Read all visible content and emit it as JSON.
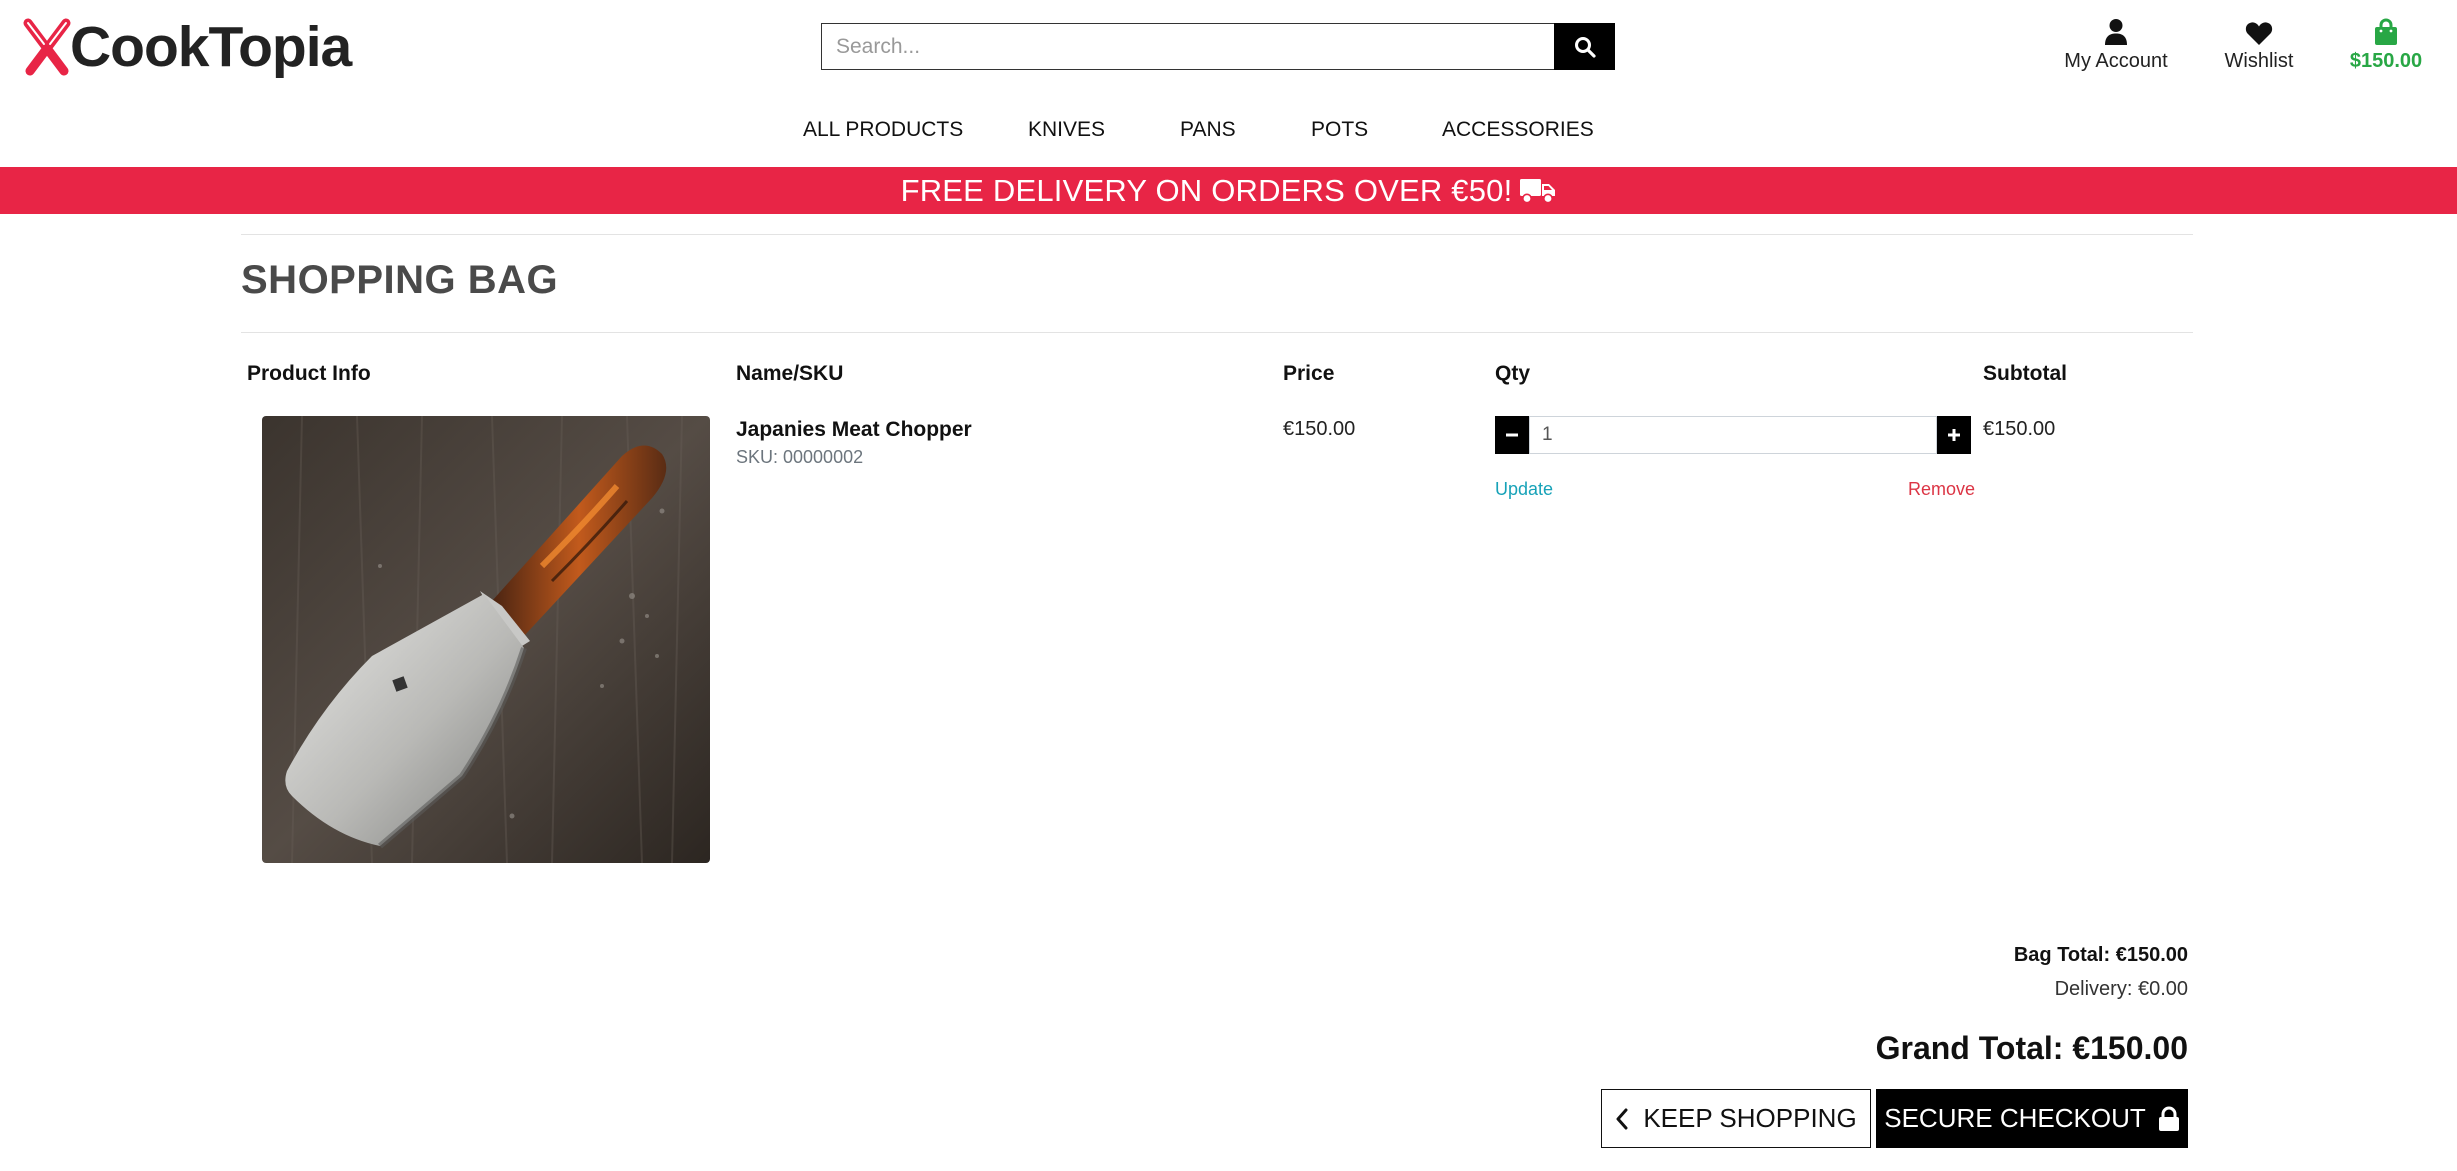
{
  "brand": {
    "name": "CookTopia",
    "accent_color": "#e82546",
    "logo_icon": "crossed-knives-icon"
  },
  "search": {
    "placeholder": "Search...",
    "button_icon": "search-icon"
  },
  "header": {
    "account_label": "My Account",
    "wishlist_label": "Wishlist",
    "bag_total": "$150.00",
    "bag_color": "#28a745"
  },
  "nav": {
    "items": [
      "ALL PRODUCTS",
      "KNIVES",
      "PANS",
      "POTS",
      "ACCESSORIES"
    ]
  },
  "banner": {
    "text": "FREE DELIVERY ON ORDERS OVER €50!",
    "icon": "truck-icon"
  },
  "page": {
    "title": "SHOPPING BAG"
  },
  "table": {
    "headers": [
      "Product Info",
      "Name/SKU",
      "Price",
      "Qty",
      "Subtotal"
    ]
  },
  "item": {
    "name": "Japanies Meat Chopper",
    "sku": "SKU: 00000002",
    "price": "€150.00",
    "qty": "1",
    "subtotal": "€150.00",
    "update_label": "Update",
    "remove_label": "Remove"
  },
  "totals": {
    "bag_total": "Bag Total: €150.00",
    "delivery": "Delivery: €0.00",
    "grand_total": "Grand Total: €150.00"
  },
  "actions": {
    "keep_shopping": "KEEP SHOPPING",
    "secure_checkout": "SECURE CHECKOUT"
  }
}
